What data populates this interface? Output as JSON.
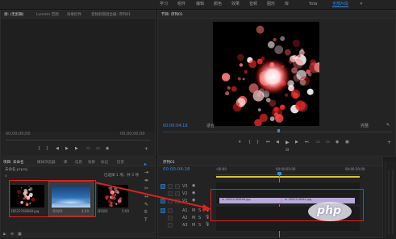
{
  "menu": {
    "items": [
      "学习",
      "组件",
      "编辑",
      "颜色",
      "效果",
      "音频",
      "图形",
      "库",
      "Yota",
      "全部片段"
    ],
    "active_index": 9
  },
  "source_panel": {
    "tabs": [
      "源: (无剪辑)",
      "Lumetri 范围",
      "效果控件",
      "音频剪辑混合器: 序列01"
    ],
    "timecode_left": "00;00;00;00",
    "timecode_right": "00;00;00;00"
  },
  "program": {
    "title": "节目: 序列01",
    "timecode": "00:00:04:18",
    "fit": "适合",
    "quality": "完整"
  },
  "project": {
    "tabs": [
      "项目: 未命名",
      "媒体浏览器",
      "库",
      "信息",
      "效果",
      "标记",
      "历史"
    ],
    "path": "未命名.prproj",
    "count": "已选择 1 项，共 3 项",
    "items": [
      {
        "name": "18522160848.jpg",
        "duration": "4;29"
      },
      {
        "name": "序列01",
        "duration": "4;29"
      },
      {
        "name": "序列01",
        "duration": "5;00"
      }
    ]
  },
  "timeline": {
    "tab": "序列01",
    "timecode": "00:00:04:18",
    "ruler": [
      ":00:00",
      "00:00:05:00",
      "00:00:10:00"
    ],
    "video_tracks": [
      "V3",
      "V2",
      "V1"
    ],
    "audio_tracks": [
      "A1",
      "A2",
      "A3"
    ],
    "clips": [
      {
        "label": "fx 18522160848.jpg"
      },
      {
        "label": "fx 1852216084.jpg"
      }
    ]
  },
  "watermark": "php",
  "colors": {
    "accent": "#2d8ceb",
    "annotation": "#e02020",
    "clip_video": "#b7a9d8",
    "clip_pink": "#d889c7"
  }
}
